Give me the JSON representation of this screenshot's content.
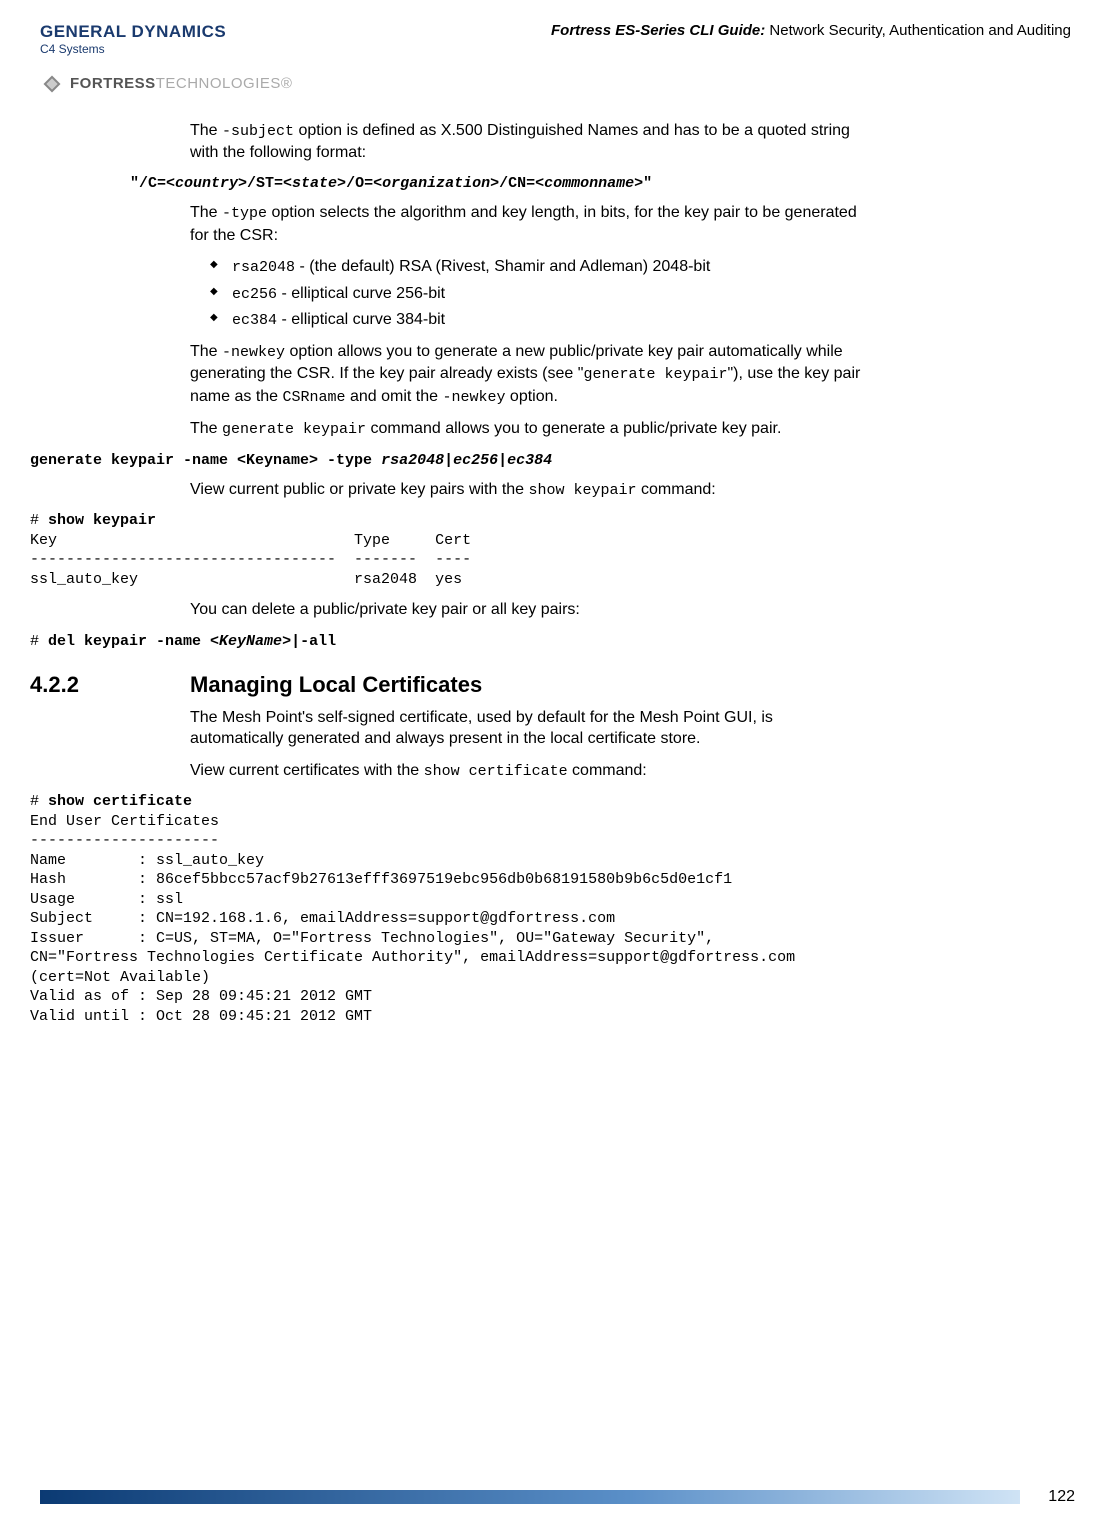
{
  "header": {
    "gd_logo": "GENERAL DYNAMICS",
    "gd_sublogo": "C4 Systems",
    "fortress_logo_strong": "FORTRESS",
    "fortress_logo_light": "TECHNOLOGIES®",
    "guide_title": "Fortress ES-Series CLI Guide:",
    "guide_section": " Network Security, Authentication and Auditing"
  },
  "p1_a": "The ",
  "p1_code": "-subject",
  "p1_b": " option is defined as X.500 Distinguished Names and has to be a quoted string with the following format:",
  "cmd_subject_a": "\"/C=",
  "cmd_subject_i1": "<country>",
  "cmd_subject_b": "/ST=",
  "cmd_subject_i2": "<state>",
  "cmd_subject_c": "/O=",
  "cmd_subject_i3": "<organization>",
  "cmd_subject_d": "/CN=",
  "cmd_subject_i4": "<commonname>",
  "cmd_subject_e": "\"",
  "p2_a": "The ",
  "p2_code": "-type",
  "p2_b": " option selects the algorithm and key length, in bits, for the key pair to be generated for the CSR:",
  "li1_code": "rsa2048",
  "li1_text": " - (the default) RSA (Rivest, Shamir and Adleman) 2048-bit",
  "li2_code": "ec256",
  "li2_text": " - elliptical curve 256-bit",
  "li3_code": "ec384",
  "li3_text": " - elliptical curve 384-bit",
  "p3_a": "The ",
  "p3_code1": "-newkey",
  "p3_b": " option allows you to generate a new public/private key pair automatically while generating the CSR. If the key pair already exists (see \"",
  "p3_code2": "generate keypair",
  "p3_c": "\"), use the key pair name as the ",
  "p3_code3": "CSRname",
  "p3_d": " and omit the ",
  "p3_code4": "-newkey",
  "p3_e": " option.",
  "p4_a": "The ",
  "p4_code1": "generate keypair",
  "p4_b": " command allows you to generate a public/private key pair.",
  "cmd_gen_a": "generate keypair -name <Keyname> -type ",
  "cmd_gen_i": "rsa2048|ec256|ec384",
  "p5_a": "View current public or private key pairs with the ",
  "p5_code": "show keypair",
  "p5_b": " command:",
  "term_show_keypair": "# show keypair\nKey                                 Type     Cert\n----------------------------------  -------  ----\nssl_auto_key                        rsa2048  yes",
  "term_show_keypair_bold": "show keypair",
  "p6": "You can delete a public/private key pair or all key pairs:",
  "cmd_del_prefix": "# ",
  "cmd_del_a": "del keypair -name <",
  "cmd_del_i": "KeyName",
  "cmd_del_b": ">|-all",
  "section_num": "4.2.2",
  "section_title": "Managing Local Certificates",
  "p7": "The Mesh Point's self-signed certificate, used by default for the Mesh Point GUI, is automatically generated and always present in the local certificate store.",
  "p8_a": "View current certificates with the ",
  "p8_code": "show certificate",
  "p8_b": " command:",
  "term_show_cert_bold": "show certificate",
  "term_show_cert_body": "End User Certificates\n---------------------\nName        : ssl_auto_key\nHash        : 86cef5bbcc57acf9b27613efff3697519ebc956db0b68191580b9b6c5d0e1cf1\nUsage       : ssl\nSubject     : CN=192.168.1.6, emailAddress=support@gdfortress.com\nIssuer      : C=US, ST=MA, O=\"Fortress Technologies\", OU=\"Gateway Security\", \nCN=\"Fortress Technologies Certificate Authority\", emailAddress=support@gdfortress.com \n(cert=Not Available)\nValid as of : Sep 28 09:45:21 2012 GMT\nValid until : Oct 28 09:45:21 2012 GMT",
  "page_num": "122"
}
